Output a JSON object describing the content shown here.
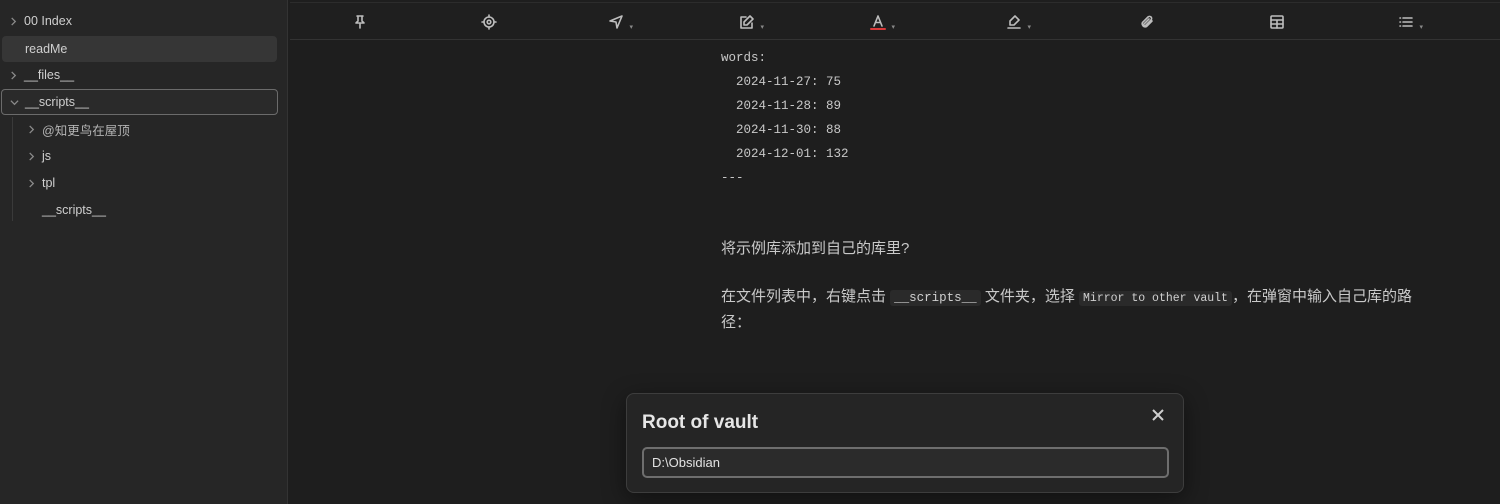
{
  "sidebar": {
    "items": [
      {
        "label": "00 Index"
      },
      {
        "label": "readMe"
      },
      {
        "label": "__files__"
      },
      {
        "label": "__scripts__"
      },
      {
        "label": "@知更鸟在屋顶"
      },
      {
        "label": "js"
      },
      {
        "label": "tpl"
      },
      {
        "label": "__scripts__"
      }
    ]
  },
  "toolbar": {
    "buttons": [
      "pin-icon",
      "target-icon",
      "navigate-icon",
      "edit-icon",
      "text-color-icon",
      "highlight-icon",
      "attachment-icon",
      "table-icon",
      "list-icon"
    ]
  },
  "editor": {
    "frontmatter": {
      "key": "words:",
      "entries": [
        "  2024-11-27: 75",
        "  2024-11-28: 89",
        "  2024-11-30: 88",
        "  2024-12-01: 132"
      ],
      "end": "---"
    },
    "question": "将示例库添加到自己的库里?",
    "instruction": {
      "part1": "在文件列表中，右键点击 ",
      "code1": "__scripts__",
      "part2": " 文件夹，选择 ",
      "code2": "Mirror to other vault",
      "part3": "，在弹窗中输入自己库的路径："
    }
  },
  "modal": {
    "title": "Root of vault",
    "input_value": "D:\\Obsidian"
  },
  "colors": {
    "text_color_underline": "#d93a3a"
  }
}
